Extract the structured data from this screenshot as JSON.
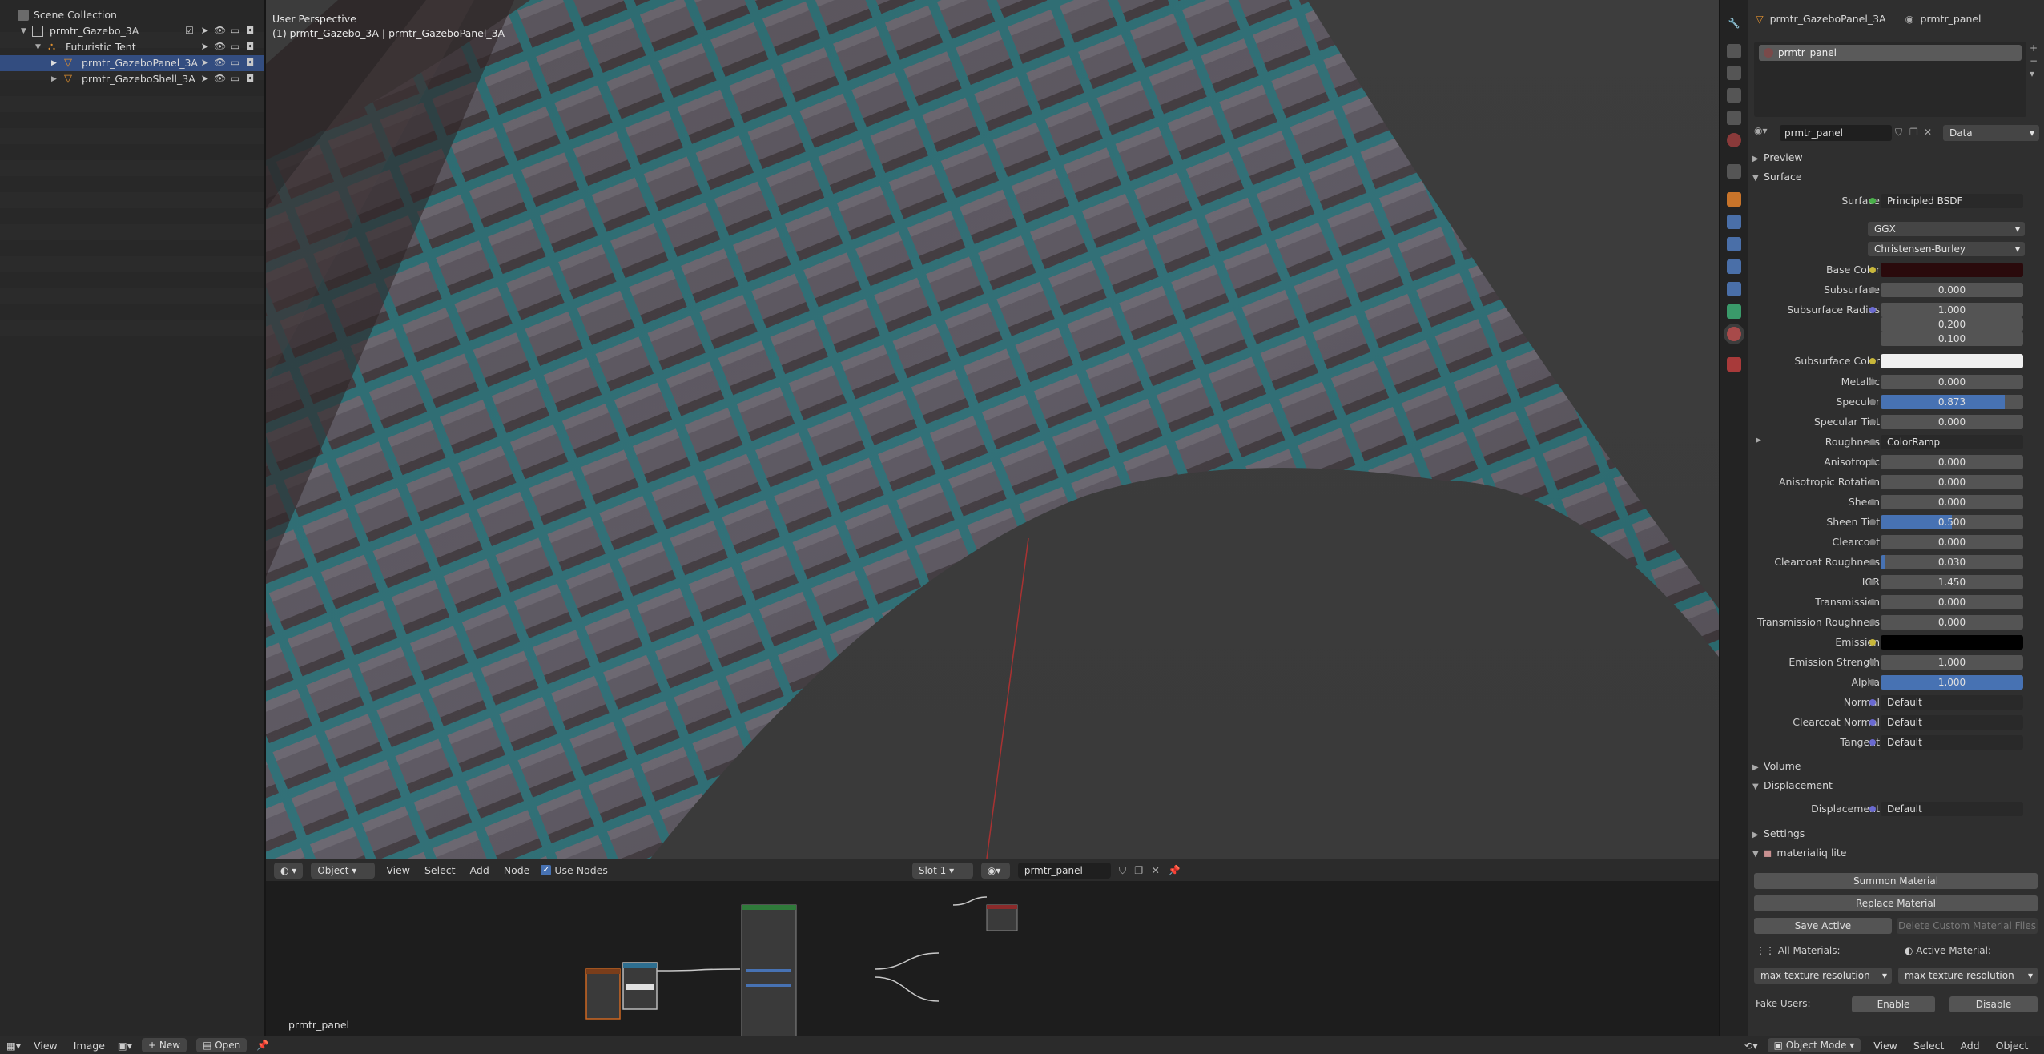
{
  "outliner": {
    "scene_collection": "Scene Collection",
    "items": [
      {
        "label": "prmtr_Gazebo_3A"
      },
      {
        "label": "Futuristic Tent"
      },
      {
        "label": "prmtr_GazeboPanel_3A"
      },
      {
        "label": "prmtr_GazeboShell_3A"
      }
    ]
  },
  "viewport": {
    "perspective": "User Perspective",
    "object_info": "(1) prmtr_Gazebo_3A | prmtr_GazeboPanel_3A"
  },
  "node_header": {
    "mode": "Object",
    "menus": [
      "View",
      "Select",
      "Add",
      "Node"
    ],
    "use_nodes": "Use Nodes",
    "slot": "Slot 1",
    "material": "prmtr_panel"
  },
  "node_editor": {
    "label": "prmtr_panel"
  },
  "statusbar": {
    "menus": [
      "View",
      "Image"
    ],
    "new": "New",
    "open": "Open",
    "mode": "Object Mode",
    "right_menus": [
      "View",
      "Select",
      "Add",
      "Object"
    ]
  },
  "properties": {
    "object": "prmtr_GazeboPanel_3A",
    "material": "prmtr_panel",
    "slot_item": "prmtr_panel",
    "mat_field": "prmtr_panel",
    "link": "Data",
    "preview": "Preview",
    "surface_header": "Surface",
    "surface_label": "Surface",
    "surface_value": "Principled BSDF",
    "distribution": "GGX",
    "subsurface_method": "Christensen-Burley",
    "rows": [
      {
        "label": "Base Color",
        "value": ""
      },
      {
        "label": "Subsurface",
        "value": "0.000"
      },
      {
        "label": "Subsurface Radius",
        "value": "1.000"
      },
      {
        "label": "",
        "value": "0.200"
      },
      {
        "label": "",
        "value": "0.100"
      },
      {
        "label": "Subsurface Color",
        "value": ""
      },
      {
        "label": "Metallic",
        "value": "0.000"
      },
      {
        "label": "Specular",
        "value": "0.873"
      },
      {
        "label": "Specular Tint",
        "value": "0.000"
      },
      {
        "label": "Roughness",
        "value": "ColorRamp"
      },
      {
        "label": "Anisotropic",
        "value": "0.000"
      },
      {
        "label": "Anisotropic Rotation",
        "value": "0.000"
      },
      {
        "label": "Sheen",
        "value": "0.000"
      },
      {
        "label": "Sheen Tint",
        "value": "0.500"
      },
      {
        "label": "Clearcoat",
        "value": "0.000"
      },
      {
        "label": "Clearcoat Roughness",
        "value": "0.030"
      },
      {
        "label": "IOR",
        "value": "1.450"
      },
      {
        "label": "Transmission",
        "value": "0.000"
      },
      {
        "label": "Transmission Roughness",
        "value": "0.000"
      },
      {
        "label": "Emission",
        "value": ""
      },
      {
        "label": "Emission Strength",
        "value": "1.000"
      },
      {
        "label": "Alpha",
        "value": "1.000"
      },
      {
        "label": "Normal",
        "value": "Default"
      },
      {
        "label": "Clearcoat Normal",
        "value": "Default"
      },
      {
        "label": "Tangent",
        "value": "Default"
      }
    ],
    "levels": {
      "specular": 0.873,
      "sheen_tint": 0.5,
      "clearcoat_roughness": 0.03,
      "alpha": 1.0
    },
    "colors": {
      "base_color": "#2a0a0c",
      "subsurface_color": "#f0f0f0",
      "emission": "#000000",
      "accent": "#4772b3"
    },
    "volume": "Volume",
    "displacement_header": "Displacement",
    "displacement_label": "Displacement",
    "displacement_value": "Default",
    "settings": "Settings",
    "addon": "materialiq lite",
    "summon": "Summon Material",
    "replace": "Replace Material",
    "save_active": "Save Active",
    "delete_custom": "Delete Custom Material Files",
    "all_materials": "All Materials:",
    "active_material": "Active Material:",
    "max_res_1": "max texture resolution",
    "max_res_2": "max texture resolution",
    "fake_users": "Fake Users:",
    "enable": "Enable",
    "disable": "Disable"
  }
}
